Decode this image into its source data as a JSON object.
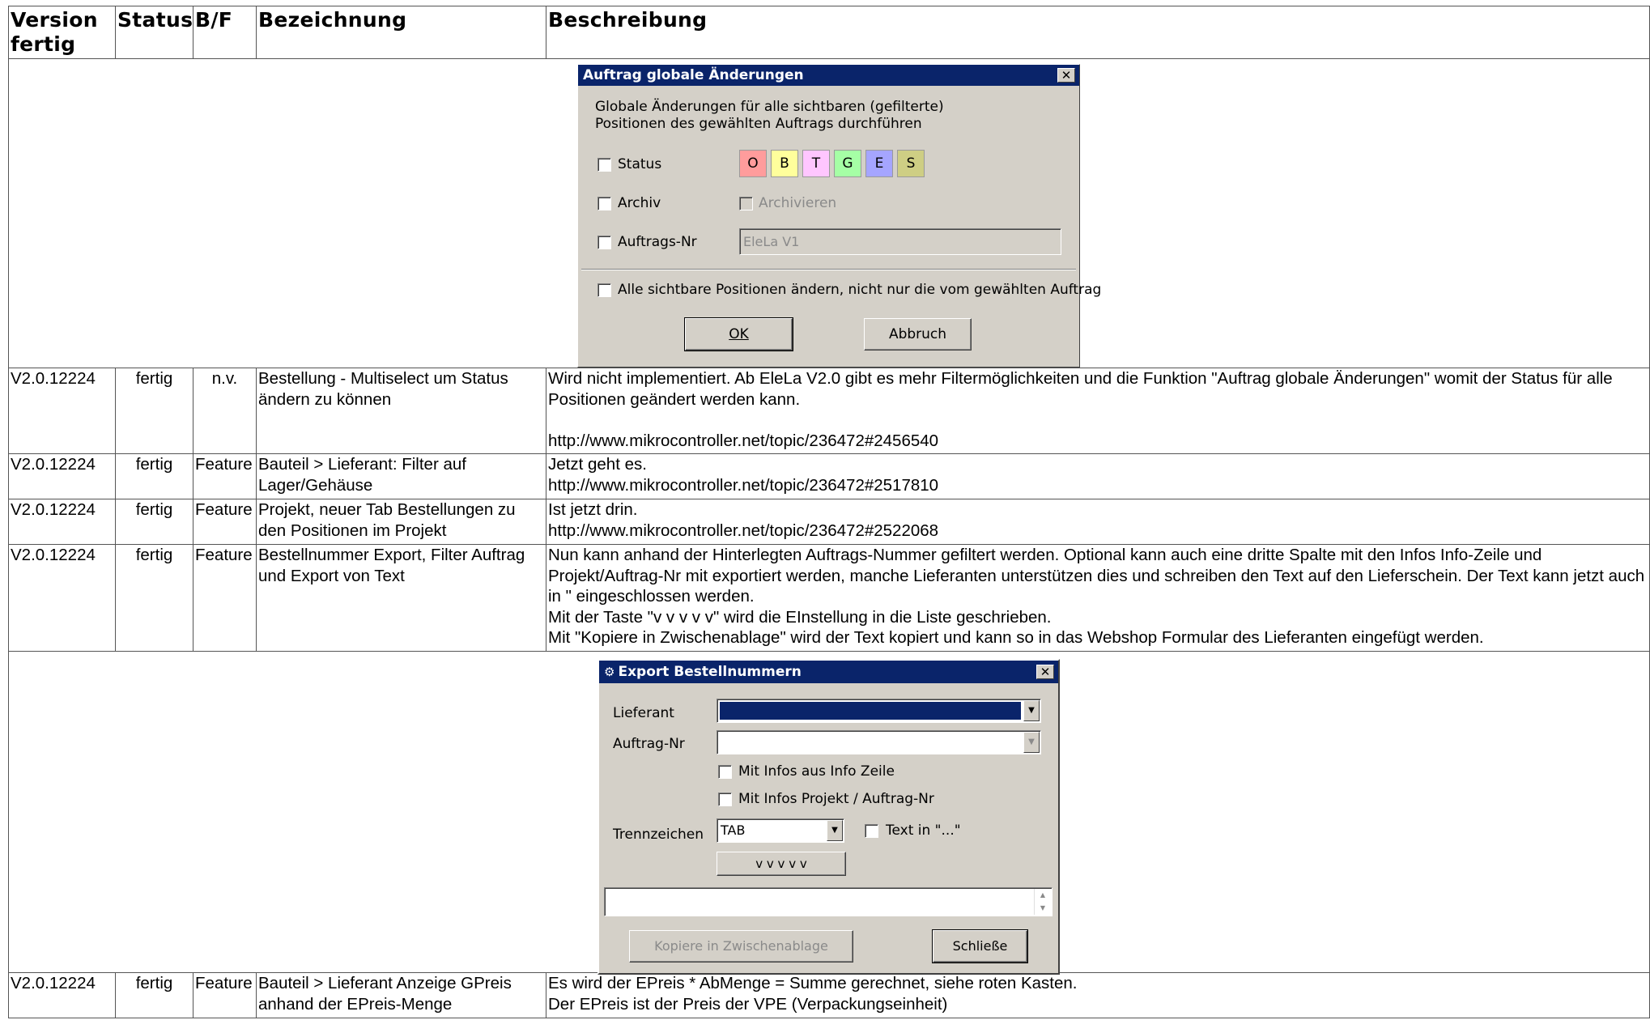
{
  "headers": {
    "version": "Version fertig",
    "status": "Status",
    "bf": "B/F",
    "name": "Bezeichnung",
    "desc": "Beschreibung"
  },
  "dialog1": {
    "title": "Auftrag globale Änderungen",
    "intro_line1": "Globale Änderungen für alle sichtbaren (gefilterte)",
    "intro_line2": "Positionen des gewählten Auftrags durchführen",
    "status_label": "Status",
    "archiv_label": "Archiv",
    "archivieren_label": "Archivieren",
    "auftrags_nr_label": "Auftrags-Nr",
    "auftrags_nr_value": "EleLa V1",
    "alle_label": "Alle sichtbare Positionen ändern, nicht nur die vom gewählten Auftrag",
    "ok_label": "OK",
    "abbruch_label": "Abbruch",
    "status_swatches": [
      {
        "letter": "O",
        "color": "#ff9c9c"
      },
      {
        "letter": "B",
        "color": "#ffff9c"
      },
      {
        "letter": "T",
        "color": "#ffc6ff"
      },
      {
        "letter": "G",
        "color": "#a5ffa5"
      },
      {
        "letter": "E",
        "color": "#a5a5ff"
      },
      {
        "letter": "S",
        "color": "#cece84"
      }
    ]
  },
  "dialog2": {
    "title": "Export Bestellnummern",
    "lieferant_label": "Lieferant",
    "auftrag_label": "Auftrag-Nr",
    "mit_info_zeile": "Mit Infos aus Info Zeile",
    "mit_info_projekt": "Mit Infos Projekt / Auftrag-Nr",
    "trennzeichen_label": "Trennzeichen",
    "trennzeichen_value": "TAB",
    "text_in_label": "Text in \"...\"",
    "vvvvv_label": "v v v v v",
    "kopiere_label": "Kopiere in Zwischenablage",
    "schliesse_label": "Schließe"
  },
  "rows": [
    {
      "version": "V2.0.12224",
      "status": "fertig",
      "bf": "n.v.",
      "name": "Bestellung - Multiselect um Status ändern zu können",
      "desc": [
        "Wird nicht implementiert. Ab EleLa V2.0 gibt es mehr Filtermöglichkeiten und die Funktion \"Auftrag globale Änderungen\" womit der Status für alle Positionen geändert werden kann.",
        "",
        "http://www.mikrocontroller.net/topic/236472#2456540"
      ]
    },
    {
      "version": "V2.0.12224",
      "status": "fertig",
      "bf": "Feature",
      "name": "Bauteil > Lieferant: Filter auf Lager/Gehäuse",
      "desc": [
        "Jetzt geht es.",
        "http://www.mikrocontroller.net/topic/236472#2517810"
      ]
    },
    {
      "version": "V2.0.12224",
      "status": "fertig",
      "bf": "Feature",
      "name": "Projekt, neuer Tab Bestellungen zu den Positionen im Projekt",
      "desc": [
        "Ist jetzt drin.",
        "http://www.mikrocontroller.net/topic/236472#2522068"
      ]
    },
    {
      "version": "V2.0.12224",
      "status": "fertig",
      "bf": "Feature",
      "name": "Bestellnummer Export, Filter Auftrag und Export von Text",
      "desc": [
        "Nun kann anhand der Hinterlegten Auftrags-Nummer gefiltert werden. Optional kann auch eine dritte Spalte mit den Infos Info-Zeile und Projekt/Auftrag-Nr mit exportiert werden, manche Lieferanten unterstützen dies und schreiben den Text auf den Lieferschein. Der Text kann jetzt auch in \" eingeschlossen werden.",
        "Mit der Taste \"v v v v v\" wird die EInstellung in die Liste geschrieben.",
        "Mit \"Kopiere in Zwischenablage\" wird der Text kopiert und kann so in das Webshop Formular des Lieferanten eingefügt werden."
      ]
    },
    {
      "version": "V2.0.12224",
      "status": "fertig",
      "bf": "Feature",
      "name": "Bauteil > Lieferant Anzeige GPreis anhand der EPreis-Menge",
      "desc": [
        "Es wird der EPreis * AbMenge = Summe gerechnet, siehe roten Kasten.",
        "Der EPreis ist der Preis der VPE (Verpackungseinheit)"
      ]
    }
  ]
}
